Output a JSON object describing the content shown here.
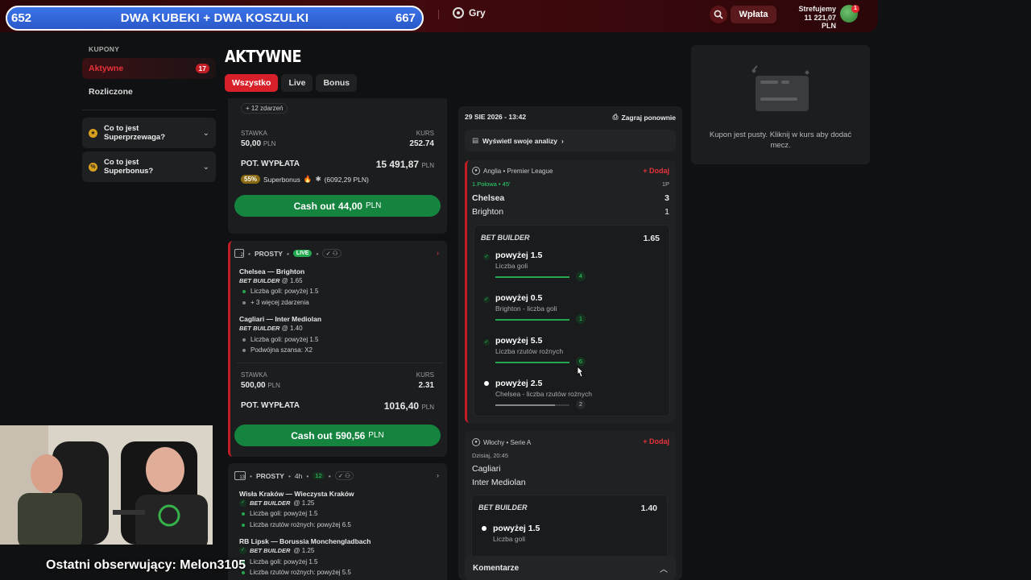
{
  "overlay": {
    "goal_left": "652",
    "goal_title": "DWA KUBEKI + DWA KOSZULKI",
    "goal_right": "667",
    "goal_progress": 0.98,
    "last_follower": "Ostatni obserwujący: Melon3105"
  },
  "header": {
    "nav_games": "Gry",
    "deposit_label": "Wpłata",
    "user_name": "Strefujemy",
    "balance": "11 221,07 PLN",
    "notification_count": "1"
  },
  "sidebar": {
    "section_title": "KUPONY",
    "items": [
      {
        "label": "Aktywne",
        "count": "17"
      },
      {
        "label": "Rozliczone"
      }
    ],
    "info_cards": [
      {
        "line1": "Co to jest",
        "line2": "Superprzewaga?"
      },
      {
        "line1": "Co to jest",
        "line2": "Superbonus?"
      }
    ]
  },
  "main": {
    "title": "AKTYWNE",
    "tabs": [
      "Wszystko",
      "Live",
      "Bonus"
    ]
  },
  "coupons": [
    {
      "more_events": "+ 12 zdarzeń",
      "stake_label": "STAWKA",
      "stake": "50,00",
      "odds_label": "KURS",
      "odds": "252.74",
      "payout_label": "POT. WYPŁATA",
      "payout": "15 491,87",
      "currency": "PLN",
      "superbonus_pct": "55%",
      "superbonus_text": "Superbonus",
      "superbonus_value": "(6092,29 PLN)",
      "cashout_label": "Cash out",
      "cashout_value": "44,00",
      "cashout_currency": "PLN"
    },
    {
      "index": "2",
      "type": "PROSTY",
      "live": "LIVE",
      "events": [
        {
          "match": "Chelsea — Brighton",
          "bb_odds": "@ 1.65",
          "lines": [
            "Liczba goli: powyżej 1.5",
            "+ 3 więcej zdarzenia"
          ]
        },
        {
          "match": "Cagliari — Inter Mediolan",
          "bb_odds": "@ 1.40",
          "lines": [
            "Liczba goli: powyżej 1.5",
            "Podwójna szansa: X2"
          ]
        }
      ],
      "stake_label": "STAWKA",
      "stake": "500,00",
      "odds_label": "KURS",
      "odds": "2.31",
      "payout_label": "POT. WYPŁATA",
      "payout": "1016,40",
      "currency": "PLN",
      "cashout_label": "Cash out",
      "cashout_value": "590,56",
      "cashout_currency": "PLN"
    },
    {
      "index": "13",
      "type": "PROSTY",
      "time": "4h",
      "count": "12",
      "events": [
        {
          "match": "Wisła Kraków — Wieczysta Kraków",
          "bb_odds": "@ 1.25",
          "lines": [
            "Liczba goli: powyżej 1.5",
            "Liczba rzutów rożnych: powyżej 6.5"
          ]
        },
        {
          "match": "RB Lipsk — Borussia Monchengladbach",
          "bb_odds": "@ 1.25",
          "lines": [
            "Liczba goli: powyżej 1.5",
            "Liczba rzutów rożnych: powyżej 5.5"
          ]
        }
      ]
    }
  ],
  "detail": {
    "date": "29 SIE 2026 - 13:42",
    "replay": "Zagraj ponownie",
    "analysis": "Wyświetl swoje analizy",
    "bet_builder_label": "BET BUILDER",
    "add_label": "+ Dodaj",
    "match1": {
      "league": "Anglia • Premier League",
      "status": "1.Połowa • 45'",
      "period": "1P",
      "home": "Chelsea",
      "home_score": "3",
      "away": "Brighton",
      "away_score": "1",
      "bb_odds": "1.65",
      "selections": [
        {
          "title": "powyżej 1.5",
          "sub": "Liczba goli",
          "value": "4",
          "progress": 1.0,
          "won": true
        },
        {
          "title": "powyżej 0.5",
          "sub": "Brighton - liczba goli",
          "value": "1",
          "progress": 1.0,
          "won": true
        },
        {
          "title": "powyżej 5.5",
          "sub": "Liczba rzutów rożnych",
          "value": "6",
          "progress": 1.0,
          "won": true
        },
        {
          "title": "powyżej 2.5",
          "sub": "Chelsea - liczba rzutów rożnych",
          "value": "2",
          "progress": 0.8,
          "won": false
        }
      ]
    },
    "match2": {
      "league": "Włochy • Serie A",
      "time": "Dzisiaj, 20:45",
      "home": "Cagliari",
      "away": "Inter Mediolan",
      "bb_odds": "1.40",
      "selections": [
        {
          "title": "powyżej 1.5",
          "sub": "Liczba goli"
        }
      ]
    },
    "comments": "Komentarze"
  },
  "betslip": {
    "empty_text": "Kupon jest pusty. Kliknij w kurs aby dodać mecz."
  }
}
